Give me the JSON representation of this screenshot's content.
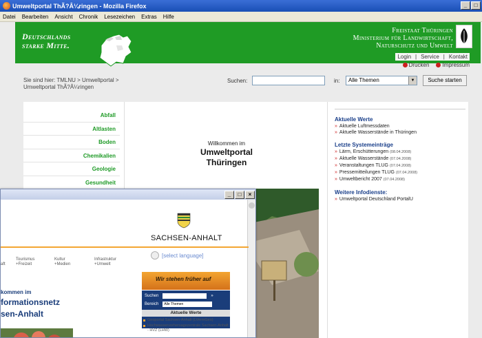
{
  "firefox": {
    "title": "Umweltportal ThÃ?Â¼ringen - Mozilla Firefox",
    "menu": [
      "Datei",
      "Bearbeiten",
      "Ansicht",
      "Chronik",
      "Lesezeichen",
      "Extras",
      "Hilfe"
    ]
  },
  "banner": {
    "slogan_line1": "Deutschlands",
    "slogan_line2": "starke Mitte.",
    "ministry_line1": "Freistaat Thüringen",
    "ministry_line2": "Ministerium für Landwirtschaft,",
    "ministry_line3": "Naturschutz und Umwelt",
    "brand_color": "#1f9b25"
  },
  "toplinks": {
    "login": "Login",
    "service": "Service",
    "contact": "Kontakt",
    "print": "Drucken",
    "imprint": "Impressum"
  },
  "breadcrumb": {
    "text1": "Sie sind hier:  TMLNU  >  Umweltportal  >",
    "text2": "Umweltportal ThÃ?Â¼ringen"
  },
  "search": {
    "label": "Suchen:",
    "value": "",
    "in_label": "in:",
    "select_value": "Alle Themen",
    "button": "Suche starten"
  },
  "left_nav": [
    "Abfall",
    "Altlasten",
    "Boden",
    "Chemikalien",
    "Geologie",
    "Gesundheit"
  ],
  "welcome": {
    "small": "Willkommen im",
    "line1": "Umweltportal",
    "line2": "Thüringen"
  },
  "right": {
    "sections": [
      {
        "title": "Aktuelle Werte",
        "items": [
          {
            "text": "Aktuelle Luftmessdaten",
            "date": ""
          },
          {
            "text": "Aktuelle Wasserstände in Thüringen",
            "date": ""
          }
        ]
      },
      {
        "title": "Letzte Systemeinträge",
        "items": [
          {
            "text": "Lärm, Erschütterungen",
            "date": "(08.04.2008)"
          },
          {
            "text": "Aktuelle Wasserstände",
            "date": "(07.04.2008)"
          },
          {
            "text": "Veranstaltungen TLUG",
            "date": "(07.04.2008)"
          },
          {
            "text": "Pressemitteilungen TLUG",
            "date": "(07.04.2008)"
          },
          {
            "text": "Umweltbericht 2007",
            "date": "(07.04.2008)"
          }
        ]
      },
      {
        "title": "Weitere Infodienste:",
        "items": [
          {
            "text": "Umweltportal Deutschland PortalU",
            "date": ""
          }
        ]
      }
    ]
  },
  "sa_window": {
    "state_name": "SACHSEN-ANHALT",
    "lang": "[select language]",
    "nav_col1": "Tourismus",
    "nav_col1b": "+Freizeit",
    "nav_col0b": "aft",
    "nav_col2": "Kultur",
    "nav_col2b": "+Medien",
    "nav_col3": "Infrastruktur",
    "nav_col3b": "+Umwelt",
    "ad_text": "Wir stehen früher auf",
    "search_label": "Suchen",
    "area_label": "Bereich",
    "area_value": "Alle Themen",
    "news_title": "Aktuelle Werte",
    "news": [
      "Geoportal Sachsen-Anhalt (LVermGeo)",
      "Hochwasservorhersagezentrale Sachsen-Anhalt - HVZ (LHW)"
    ],
    "welcome": "kommen im",
    "heading1": "formationsnetz",
    "heading2": "sen-Anhalt"
  }
}
